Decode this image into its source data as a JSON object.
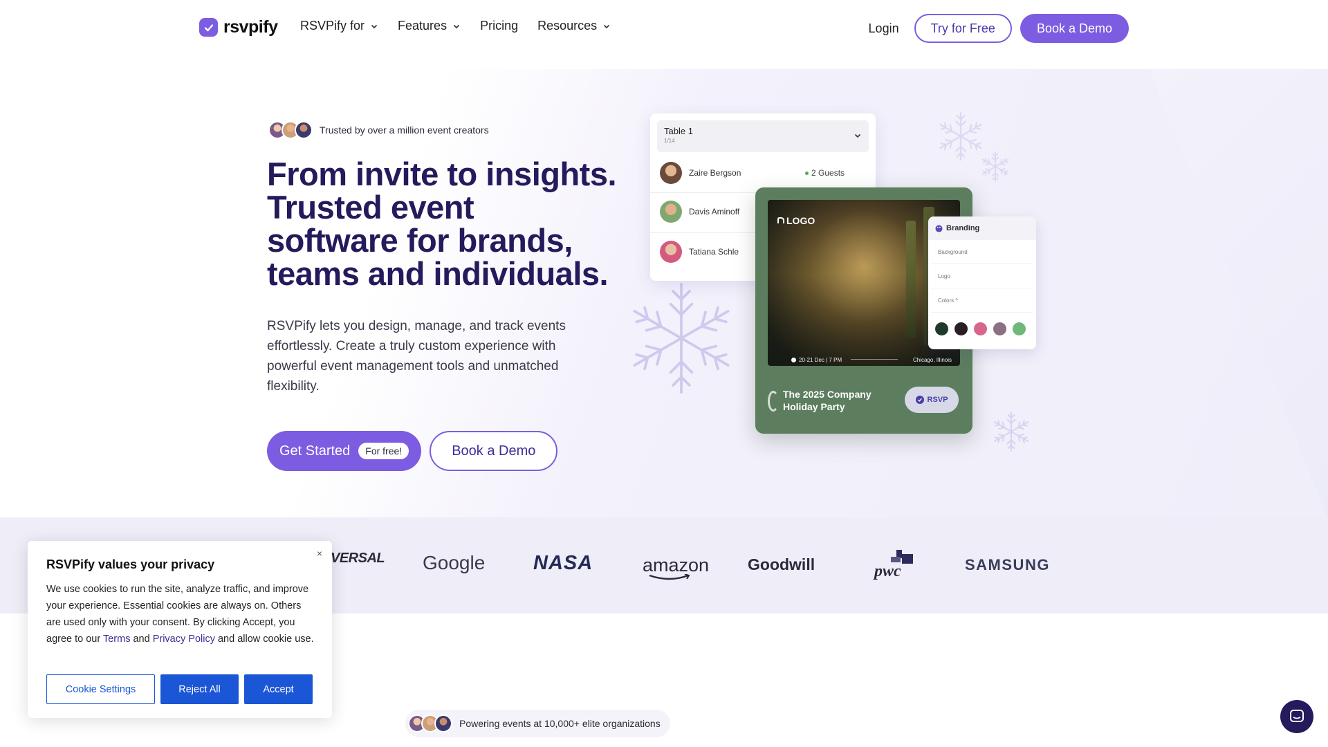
{
  "nav": {
    "brand": "rsvpify",
    "links": [
      {
        "label": "RSVPify for",
        "dropdown": true
      },
      {
        "label": "Features",
        "dropdown": true
      },
      {
        "label": "Pricing",
        "dropdown": false
      },
      {
        "label": "Resources",
        "dropdown": true
      }
    ],
    "login": "Login",
    "try_free": "Try for Free",
    "book_demo": "Book a Demo"
  },
  "hero": {
    "trusted": "Trusted by over a million event creators",
    "headline_lines": [
      "From invite to insights.",
      "Trusted event",
      "software for brands,",
      "teams and individuals."
    ],
    "subtext": "RSVPify lets you design, manage, and track events effortlessly. Create a truly custom experience with powerful event management tools and unmatched flexibility.",
    "cta_primary": "Get Started",
    "cta_primary_badge": "For free!",
    "cta_secondary": "Book a Demo"
  },
  "mockup": {
    "table": {
      "title": "Table 1",
      "sub": "1/14"
    },
    "guests": [
      {
        "name": "Zaire Bergson",
        "count": "2 Guests"
      },
      {
        "name": "Davis Aminoff",
        "count": ""
      },
      {
        "name": "Tatiana Schle",
        "count": ""
      }
    ],
    "event": {
      "logo": "LOGO",
      "date": "20-21 Dec | 7 PM",
      "location": "Chicago, Illinois",
      "title": "The 2025 Company Holiday Party",
      "rsvp": "RSVP"
    },
    "branding": {
      "title": "Branding",
      "rows": [
        "Background",
        "Logo",
        "Colors ^"
      ],
      "swatches": [
        "#1f3a2a",
        "#2a1e22",
        "#d9648c",
        "#8a7080",
        "#6fb77a"
      ]
    }
  },
  "logos": [
    "VERSAL",
    "Google",
    "NASA",
    "amazon",
    "Goodwill",
    "pwc",
    "SAMSUNG"
  ],
  "bottom": {
    "powering": "Powering events at 10,000+ elite organizations"
  },
  "cookie": {
    "title": "RSVPify values your privacy",
    "body_before": "We use cookies to run the site, analyze traffic, and improve your experience. Essential cookies are always on. Others are used only with your consent. By clicking Accept, you agree to our ",
    "terms": "Terms",
    "and": " and ",
    "privacy": "Privacy Policy",
    "body_after": " and allow cookie use.",
    "btn_settings": "Cookie Settings",
    "btn_reject": "Reject All",
    "btn_accept": "Accept",
    "close": "×"
  },
  "colors": {
    "accent": "#7c5ce0",
    "heading": "#241a5c",
    "cookie_blue": "#1a56d6"
  }
}
